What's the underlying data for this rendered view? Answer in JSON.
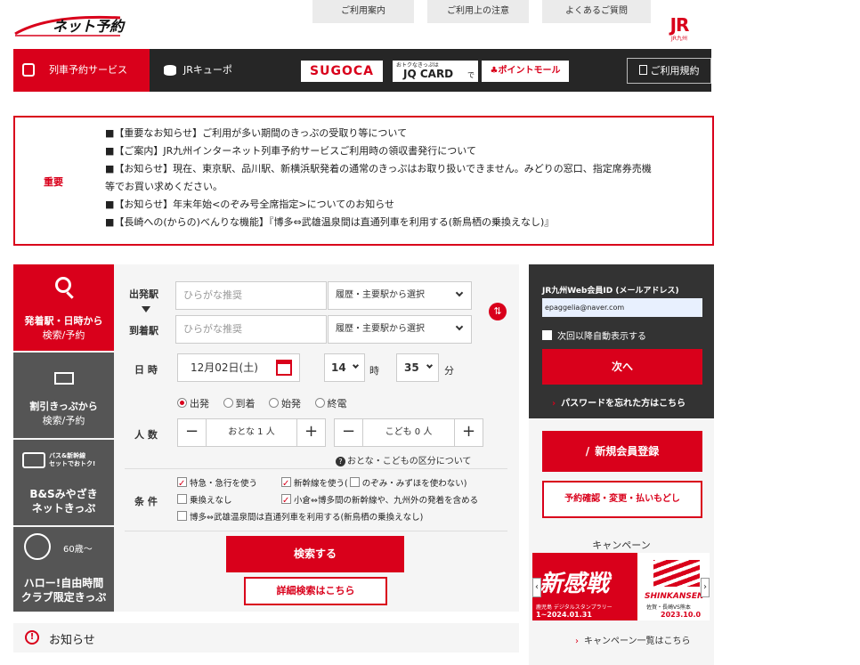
{
  "header": {
    "logo_text": "ネット予約",
    "top_links": [
      "ご利用案内",
      "ご利用上の注意",
      "よくあるご質問"
    ],
    "jr_logo_text": "JR",
    "jr_logo_sub": "JR九州"
  },
  "service_bar": {
    "tabs": [
      {
        "label": "列車予約サービス"
      },
      {
        "label": "JRキューポ"
      }
    ],
    "sugoca": "SUGOCA",
    "jqcard_small": "おトクなきっぷは",
    "jqcard": "JQ CARD",
    "jqcard_de": "で",
    "pointmall": "ポイントモール",
    "terms": "ご利用規約"
  },
  "notice": {
    "label": "重要",
    "items": [
      "■【重要なお知らせ】ご利用が多い期間のきっぷの受取り等について",
      "■【ご案内】JR九州インターネット列車予約サービスご利用時の領収書発行について",
      "■【お知らせ】現在、東京駅、品川駅、新横浜駅発着の通常のきっぷはお取り扱いできません。みどりの窓口、指定席券売機",
      "等でお買い求めください。",
      "■【お知らせ】年末年始<のぞみ号全席指定>についてのお知らせ",
      "■【長崎への(からの)べんりな機能】『博多⇔武雄温泉間は直通列車を利用する(新鳥栖の乗換えなし)』"
    ]
  },
  "left_nav": {
    "search_line1": "発着駅・日時から",
    "search_line2": "検索/予約",
    "discount_line1": "割引きっぷから",
    "discount_line2": "検索/予約",
    "bs_badge": "バス&新幹線\nセットでおトク!",
    "bs_line1": "B&Sみやざき",
    "bs_line2": "ネットきっぷ",
    "hello_badge": "60歳〜",
    "hello_line1": "ハロー!自由時間",
    "hello_line2": "クラブ限定きっぷ"
  },
  "form": {
    "from_label": "出発駅",
    "to_label": "到着駅",
    "from_placeholder": "ひらがな推奨",
    "to_placeholder": "ひらがな推奨",
    "history_select": "履歴・主要駅から選択",
    "datetime_label": "日 時",
    "date_value": "12月02日(土)",
    "hour_value": "14",
    "hour_unit": "時",
    "minute_value": "35",
    "minute_unit": "分",
    "radios": [
      {
        "label": "出発",
        "checked": true
      },
      {
        "label": "到着",
        "checked": false
      },
      {
        "label": "始発",
        "checked": false
      },
      {
        "label": "終電",
        "checked": false
      }
    ],
    "people_label": "人 数",
    "adult_value": "おとな 1 人",
    "child_value": "こども 0 人",
    "age_info": "おとな・こどもの区分について",
    "conditions_label": "条 件",
    "cond_express": "特急・急行を使う",
    "cond_shinkansen": "新幹線を使う(",
    "cond_nozomi": "のぞみ・みずほを使わない)",
    "cond_no_transfer": "乗換えなし",
    "cond_kokura": "小倉⇔博多間の新幹線や、九州外の発着を含める",
    "cond_direct": "博多⇔武雄温泉間は直通列車を利用する(新鳥栖の乗換えなし)",
    "search_button": "検索する",
    "detail_search": "詳細検索はこちら"
  },
  "login": {
    "title": "JR九州Web会員ID (メールアドレス)",
    "email_value": "epaggelia@naver.com",
    "auto_display": "次回以降自動表示する",
    "next_button": "次へ",
    "forgot": "パスワードを忘れた方はこちら"
  },
  "side": {
    "register": "新規会員登録",
    "confirm": "予約確認・変更・払いもどし",
    "campaign_title": "キャンペーン",
    "banner_text": "新感戦",
    "banner_sub": "鹿児島 デジタルスタンプラリー",
    "banner_date_left": "1~2024.01.31",
    "banner_right_title": "SHINKANSEN",
    "banner_right_sub": "佐賀・長崎VS熊本",
    "banner_date_right": "2023.10.0",
    "campaign_list": "キャンペーン一覧はこちら"
  },
  "footer": {
    "oshirase": "お知らせ"
  },
  "colors": {
    "accent": "#d9001b",
    "dark": "#262626",
    "nav_gray": "#555555"
  }
}
